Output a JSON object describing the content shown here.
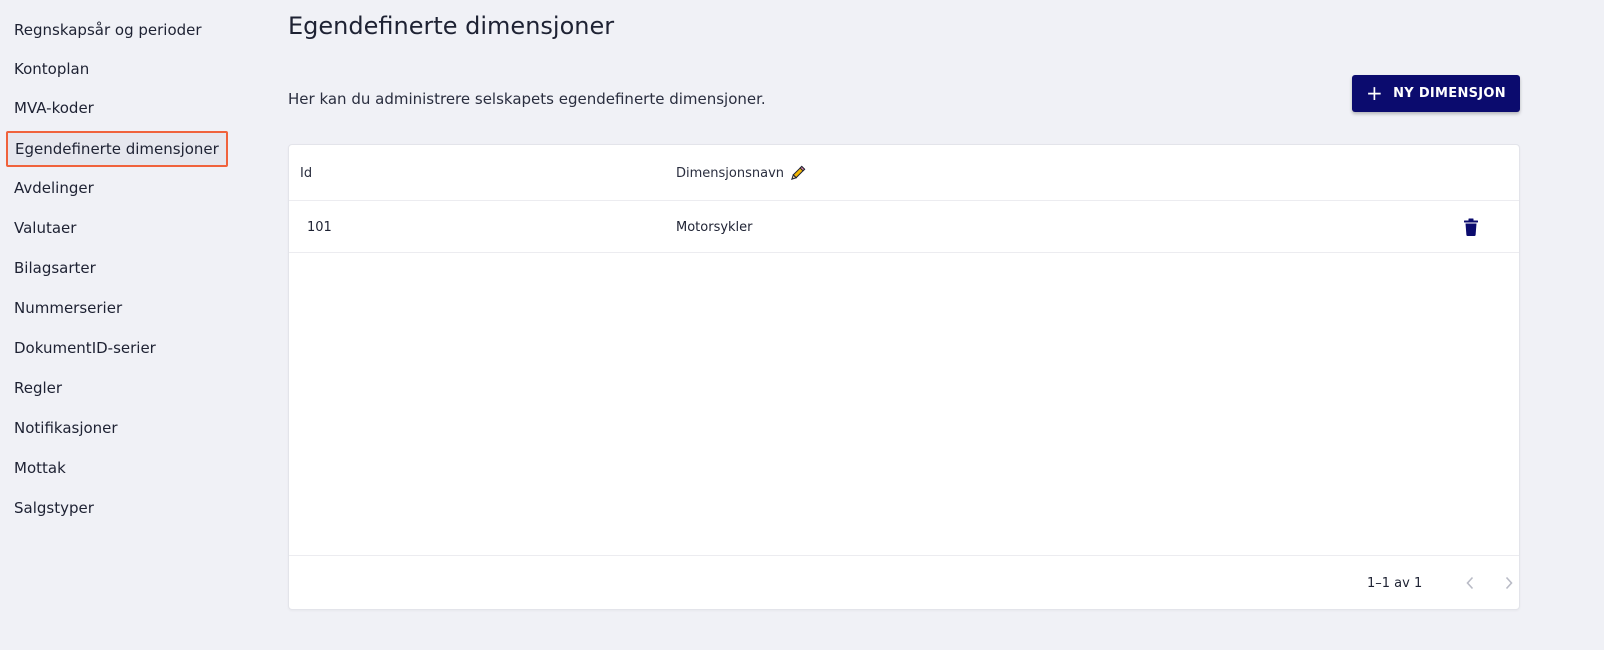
{
  "sidebar": {
    "items": [
      {
        "label": "Regnskapsår og perioder"
      },
      {
        "label": "Kontoplan"
      },
      {
        "label": "MVA-koder"
      },
      {
        "label": "Egendefinerte dimensjoner",
        "active": true
      },
      {
        "label": "Avdelinger"
      },
      {
        "label": "Valutaer"
      },
      {
        "label": "Bilagsarter"
      },
      {
        "label": "Nummerserier"
      },
      {
        "label": "DokumentID-serier"
      },
      {
        "label": "Regler"
      },
      {
        "label": "Notifikasjoner"
      },
      {
        "label": "Mottak"
      },
      {
        "label": "Salgstyper"
      }
    ]
  },
  "main": {
    "title": "Egendefinerte dimensjoner",
    "subtitle": "Her kan du administrere selskapets egendefinerte dimensjoner.",
    "new_button": {
      "icon": "plus-icon",
      "label": "NY DIMENSJON"
    }
  },
  "table": {
    "columns": [
      {
        "label": "Id"
      },
      {
        "label": "Dimensjonsnavn",
        "icon": "pencil-icon"
      }
    ],
    "rows": [
      {
        "id": "101",
        "name": "Motorsykler",
        "action_icon": "trash-icon"
      }
    ],
    "pagination": {
      "info": "1–1 av 1",
      "prev_icon": "chevron-left-icon",
      "next_icon": "chevron-right-icon"
    }
  },
  "colors": {
    "background": "#f0f1f6",
    "primary": "#0b0b6e",
    "active_outline": "#f0623c",
    "pencil": "#f2b705"
  }
}
